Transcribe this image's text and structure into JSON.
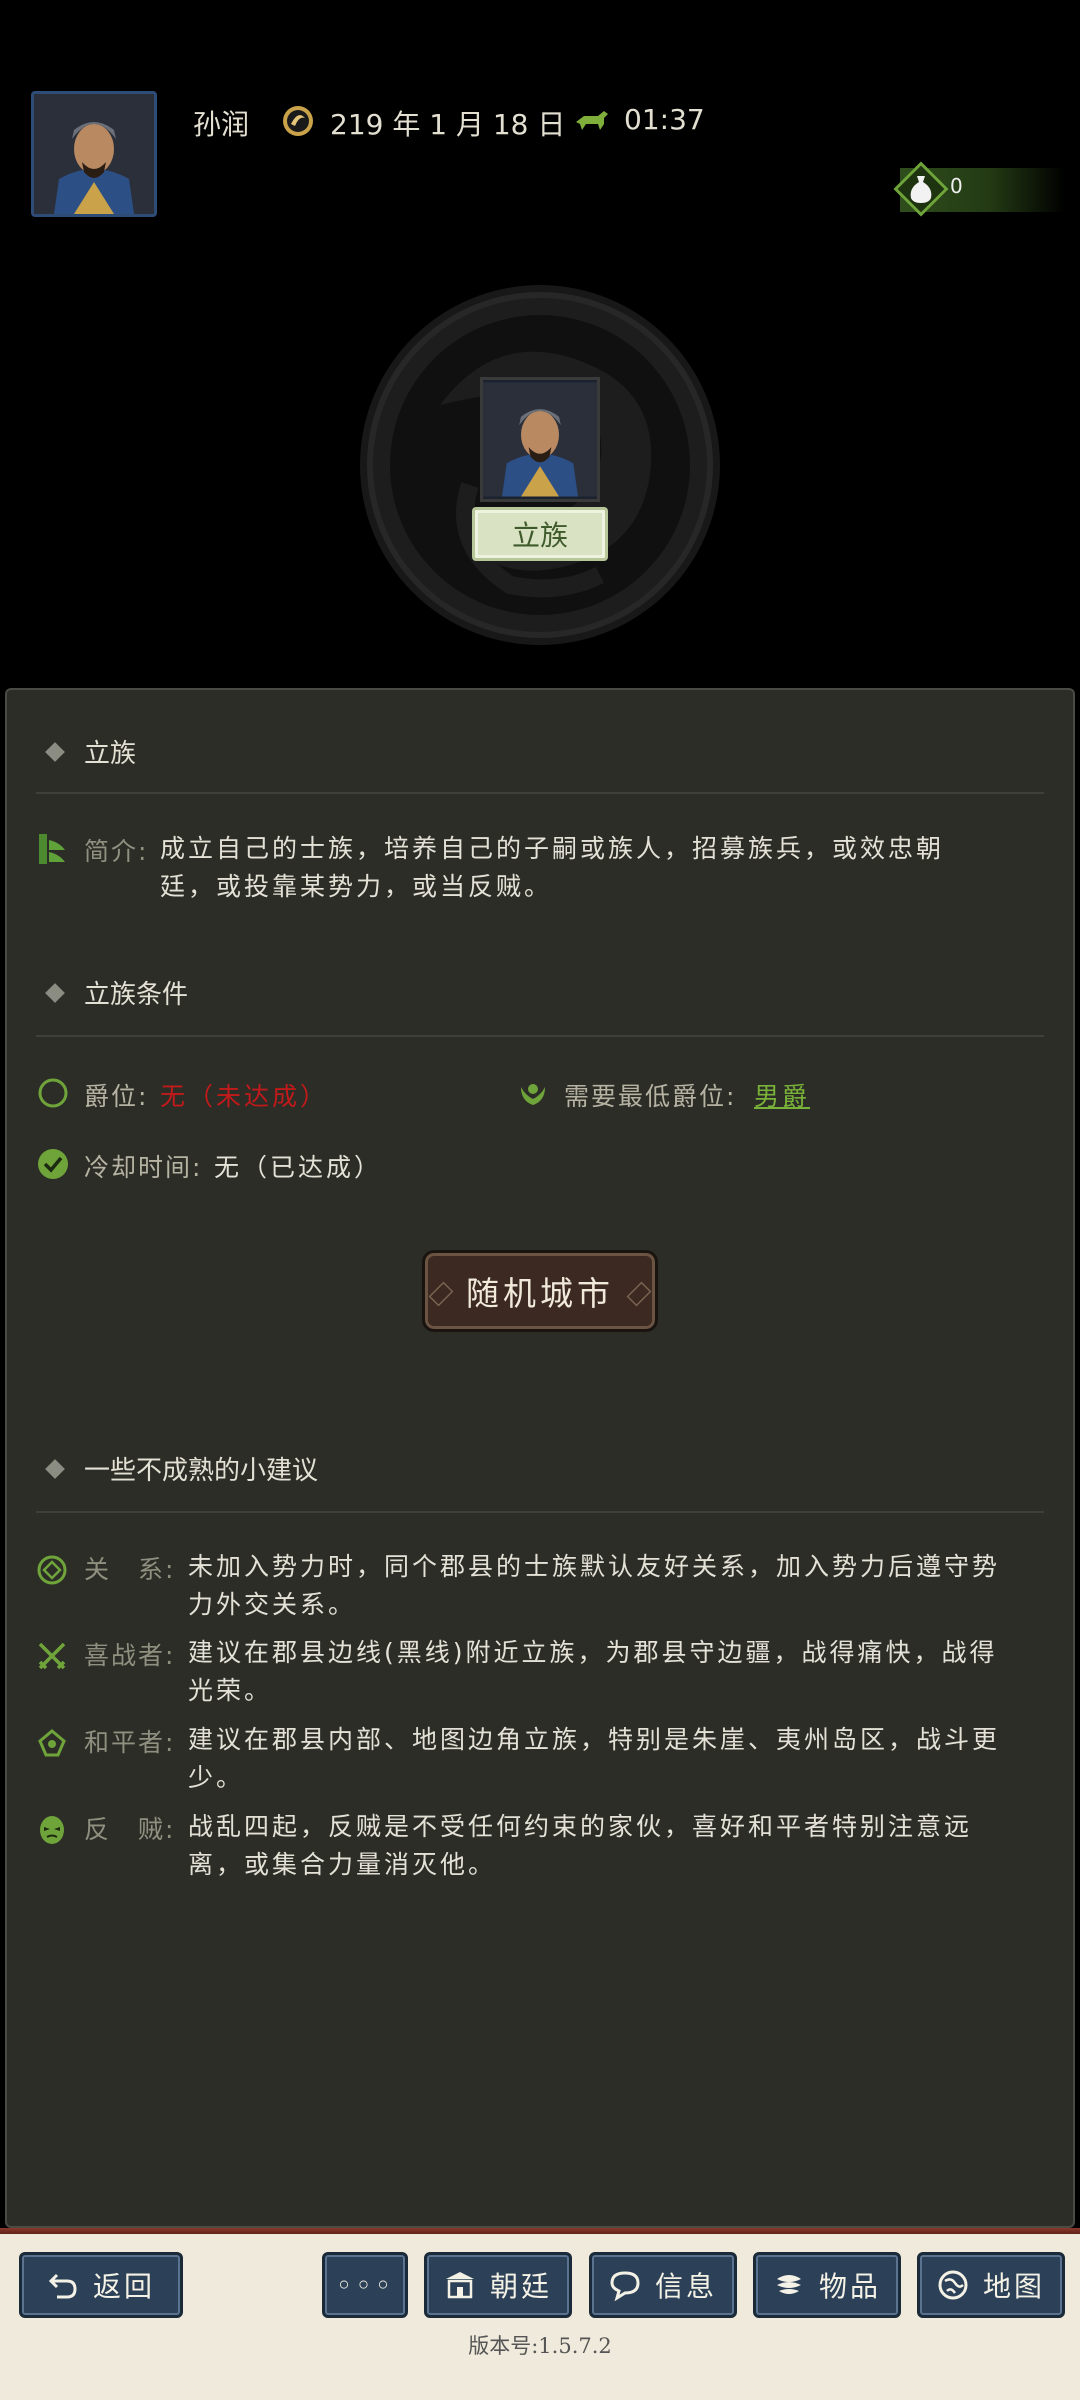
{
  "header": {
    "player_name": "孙润",
    "date": "219 年 1 月 18 日",
    "time": "01:37",
    "resource_value": "0",
    "icons": {
      "avatar": "general-portrait",
      "date": "sun-emblem-icon",
      "time": "horse-icon",
      "resource": "money-bag-icon"
    }
  },
  "emblem": {
    "center_button": "立族",
    "icon": "dragon-emblem"
  },
  "panel": {
    "section1_title": "立族",
    "intro_label": "简介:",
    "intro_text": "成立自己的士族，培养自己的子嗣或族人，招募族兵，或效忠朝廷，或投靠某势力，或当反贼。",
    "section2_title": "立族条件",
    "conditions": {
      "rank_label": "爵位:",
      "rank_value": "无（未达成）",
      "min_rank_label": "需要最低爵位:",
      "min_rank_value": "男爵",
      "cooldown_label": "冷却时间:",
      "cooldown_value": "无（已达成）"
    },
    "random_city_button": "随机城市",
    "section3_title": "一些不成熟的小建议",
    "tips": [
      {
        "label": "关　系:",
        "text": "未加入势力时，同个郡县的士族默认友好关系，加入势力后遵守势力外交关系。",
        "icon": "relation-icon"
      },
      {
        "label": "喜战者:",
        "text": "建议在郡县边线(黑线)附近立族，为郡县守边疆，战得痛快，战得光荣。",
        "icon": "crossed-swords-icon"
      },
      {
        "label": "和平者:",
        "text": "建议在郡县内部、地图边角立族，特别是朱崖、夷州岛区，战斗更少。",
        "icon": "peace-icon"
      },
      {
        "label": "反　贼:",
        "text": "战乱四起，反贼是不受任何约束的家伙，喜好和平者特别注意远离，或集合力量消灭他。",
        "icon": "rebel-mask-icon"
      }
    ]
  },
  "bottom_bar": {
    "back": "返回",
    "more": "◦◦◦",
    "court": "朝廷",
    "info": "信息",
    "items": "物品",
    "map": "地图",
    "version": "版本号:1.5.7.2"
  }
}
